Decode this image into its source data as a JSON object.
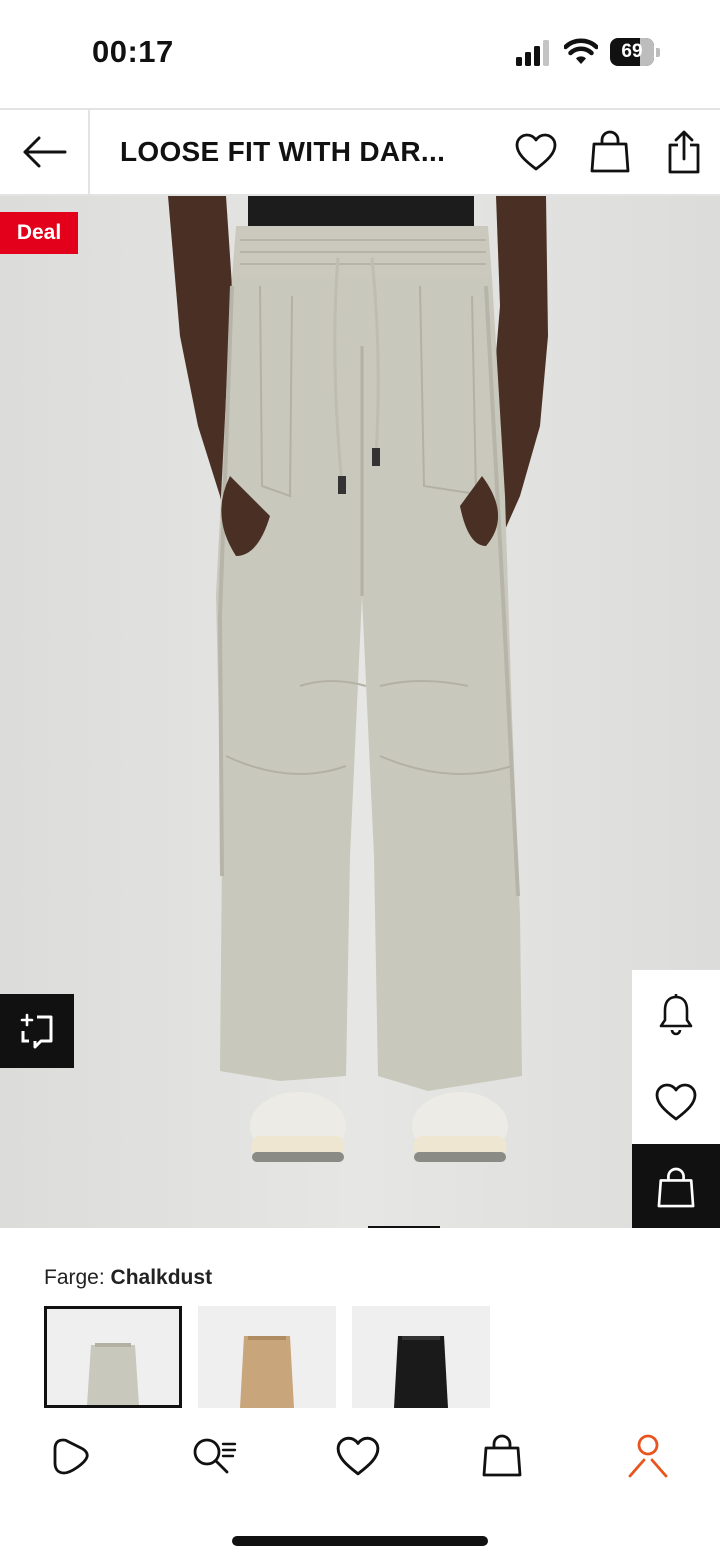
{
  "status_bar": {
    "time": "00:17",
    "battery_percent": "69",
    "battery_level": 0.69,
    "signal_bars": 3
  },
  "header": {
    "title": "LOOSE FIT WITH DAR...",
    "icons": [
      "back-arrow-icon",
      "heart-icon",
      "shopping-bag-icon",
      "share-icon"
    ]
  },
  "product": {
    "badge": "Deal",
    "icons": [
      "compare-icon",
      "bell-icon",
      "heart-icon",
      "shopping-bag-icon"
    ],
    "image_count_indicator": "active"
  },
  "colors": {
    "label": "Farge:",
    "selected": "Chalkdust",
    "swatches": [
      {
        "name": "Chalkdust",
        "color": "#c9c8bd",
        "selected": true
      },
      {
        "name": "Beige",
        "color": "#c8a57b",
        "selected": false
      },
      {
        "name": "Black",
        "color": "#1a1a1a",
        "selected": false
      }
    ]
  },
  "bottom_nav": {
    "items": [
      "home-icon",
      "search-icon",
      "wishlist-icon",
      "bag-icon",
      "profile-icon"
    ],
    "active_color": "#e8541e"
  },
  "theme": {
    "accent_red": "#e2001a",
    "profile_orange": "#e8541e"
  }
}
